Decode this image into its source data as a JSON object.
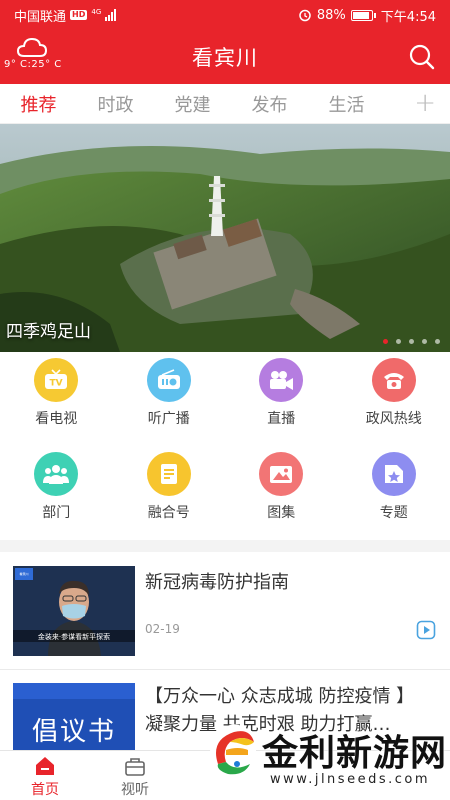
{
  "status_bar": {
    "carrier": "中国联通",
    "hd": "HD",
    "network": "4G",
    "battery": "88%",
    "battery_level": 0.88,
    "time": "下午4:54"
  },
  "header": {
    "title": "看宾川",
    "weather_temp": "9° C:25° C",
    "weather_icon": "cloud-icon"
  },
  "tabs": {
    "items": [
      {
        "label": "推荐",
        "active": true
      },
      {
        "label": "时政",
        "active": false
      },
      {
        "label": "党建",
        "active": false
      },
      {
        "label": "发布",
        "active": false
      },
      {
        "label": "生活",
        "active": false
      }
    ],
    "add": "+"
  },
  "banner": {
    "caption": "四季鸡足山",
    "slides": 5,
    "active_slide": 1
  },
  "grid": {
    "items": [
      {
        "label": "看电视",
        "icon": "tv-icon",
        "color": "#f6c932"
      },
      {
        "label": "听广播",
        "icon": "radio-icon",
        "color": "#5fc1ee"
      },
      {
        "label": "直播",
        "icon": "video-camera-icon",
        "color": "#b57de0"
      },
      {
        "label": "政风热线",
        "icon": "telephone-icon",
        "color": "#f06a6a"
      },
      {
        "label": "部门",
        "icon": "people-icon",
        "color": "#3ed1b4"
      },
      {
        "label": "融合号",
        "icon": "document-icon",
        "color": "#f7c52e"
      },
      {
        "label": "图集",
        "icon": "image-icon",
        "color": "#f27575"
      },
      {
        "label": "专题",
        "icon": "folder-star-icon",
        "color": "#8d8df0"
      }
    ]
  },
  "news": [
    {
      "title": "新冠病毒防护指南",
      "date": "02-19",
      "thumb_caption": "金装来·参谋看新平探索",
      "thumb_badge": "看宾川"
    },
    {
      "title_line1": "【万众一心 众志成城 防控疫情 】",
      "title_line2": "凝聚力量 共克时艰 助力打赢…",
      "thumb_text": "倡议书"
    }
  ],
  "bottom_nav": {
    "items": [
      {
        "label": "首页",
        "icon": "home-icon",
        "active": true
      },
      {
        "label": "视听",
        "icon": "briefcase-icon",
        "active": false
      }
    ]
  },
  "watermark": {
    "text": "金利新游网",
    "url": "www.jlnseeds.com"
  },
  "colors": {
    "brand": "#e8242b",
    "inactive_tab": "#999999"
  }
}
